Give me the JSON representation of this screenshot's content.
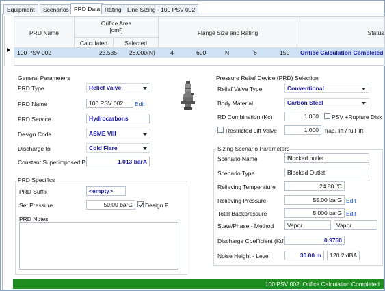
{
  "tabs": [
    {
      "label": "Equipment"
    },
    {
      "label": "Scenarios"
    },
    {
      "label": "PRD Data"
    },
    {
      "label": "Rating"
    },
    {
      "label": "Line Sizing - 100 PSV 002"
    }
  ],
  "grid": {
    "headers": {
      "prd_name": "PRD Name",
      "orifice_area": "Orifice Area",
      "orifice_unit": "[cm²]",
      "calculated": "Calculated",
      "selected": "Selected",
      "flange": "Flange Size and Rating",
      "status": "Status/"
    },
    "rows": [
      {
        "name": "100 PSV 002",
        "calculated": "23.535",
        "selected": "28.000(N)",
        "f1": "4",
        "f2": "600",
        "f3": "N",
        "f4": "6",
        "f5": "150",
        "status": "Orifice Calculation Completed"
      }
    ]
  },
  "general": {
    "title": "General Parameters",
    "prd_type_label": "PRD Type",
    "prd_type_value": "Relief Valve",
    "prd_name_label": "PRD Name",
    "prd_name_value": "100 PSV 002",
    "edit": "Edit",
    "service_label": "PRD Service",
    "service_value": "Hydrocarbons",
    "design_code_label": "Design Code",
    "design_code_value": "ASME VIII",
    "discharge_label": "Discharge to",
    "discharge_value": "Cold Flare",
    "bp_label": "Constant Superimposed BP",
    "bp_value": "1.013 barA"
  },
  "specifics": {
    "title": "PRD Specifics",
    "suffix_label": "PRD Suffix",
    "suffix_value": "<empty>",
    "set_pressure_label": "Set Pressure",
    "set_pressure_value": "50.00 barG",
    "design_p_label": "Design P.",
    "design_p_checked": true,
    "notes_label": "PRD Notes",
    "notes_value": ""
  },
  "prd_selection": {
    "title": "Pressure Relief Device (PRD) Selection",
    "valve_type_label": "Relief Valve Type",
    "valve_type_value": "Conventional",
    "body_label": "Body Material",
    "body_value": "Carbon Steel",
    "rd_label": "RD Combination (Kc)",
    "rd_value": "1.000",
    "psv_rupture_label": "PSV +Rupture Disk",
    "psv_rupture_checked": false,
    "restricted_label": "Restricted Lift Valve",
    "restricted_checked": false,
    "restricted_value": "1.000",
    "frac_label": "frac. lift / full lift"
  },
  "sizing": {
    "title": "Sizing Scenario Parameters",
    "scenario_name_label": "Scenario Name",
    "scenario_name_value": "Blocked outlet",
    "scenario_type_label": "Scenario Type",
    "scenario_type_value": "Blocked Outlet",
    "temp_label": "Relieving Temperature",
    "temp_value": "24.80 ºC",
    "rel_pressure_label": "Relieving Pressure",
    "rel_pressure_value": "55.00 barG",
    "backpressure_label": "Total Backpressure",
    "backpressure_value": "5.000 barG",
    "edit": "Edit",
    "phase_label": "State/Phase - Method",
    "phase_value1": "Vapor",
    "phase_value2": "Vapor",
    "kd_label": "Discharge Coefficient (Kd)",
    "kd_value": "0.9750",
    "noise_label": "Noise Height - Level",
    "noise_height": "30.00 m",
    "noise_level": "120.2 dBA"
  },
  "status_bar": {
    "text": "100 PSV 002: Orifice Calculation Completed",
    "color": "#1e8c1e"
  }
}
